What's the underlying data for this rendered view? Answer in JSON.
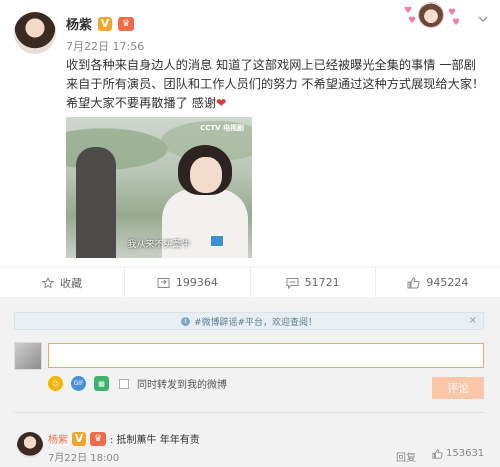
{
  "post": {
    "author": "杨紫",
    "verified_badge": "V",
    "timestamp": "7月22日 17:56",
    "text_main": "收到各种来自身边人的消息 知道了这部戏网上已经被曝光全集的事情 一部剧来自于所有演员、团队和工作人员们的努力 不希望通过这种方式展现给大家！希望大家不要再散播了 感谢",
    "text_emoji": "❤",
    "media": {
      "watermark": "CCTV 电视剧",
      "subtitle": "我从来不买薰牛"
    },
    "icons": [
      "more-icon",
      "verified-badge",
      "member-crown-icon",
      "sticker"
    ]
  },
  "actions": [
    {
      "label": "收藏",
      "icon": "star-icon"
    },
    {
      "label": "199364",
      "icon": "repost-icon"
    },
    {
      "label": "51721",
      "icon": "comment-icon"
    },
    {
      "label": "945224",
      "icon": "like-icon"
    }
  ],
  "comment_box": {
    "notice": "#微博辟谣#平台，欢迎查阅！",
    "input_value": "",
    "repost_label": "同时转发到我的微博",
    "submit_label": "评论",
    "tools": [
      "emoji-icon",
      "gif-icon",
      "image-icon"
    ]
  },
  "comment": {
    "author": "杨紫",
    "text": ": 抵制薰牛 年年有责",
    "timestamp": "7月22日 18:00",
    "reply_label": "回复",
    "like_count": "153631"
  },
  "colors": {
    "accent_orange": "#eb7350",
    "submit_disabled": "#fcc7a8",
    "input_border": "#f5a56a",
    "heart_red": "#e6352e",
    "verified_gold": "#f3a52b"
  }
}
